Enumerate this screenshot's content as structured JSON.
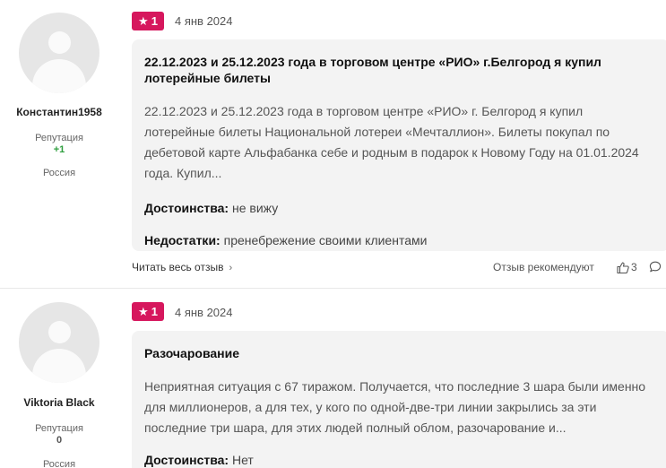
{
  "reviews": [
    {
      "author": {
        "name": "Константин1958",
        "reputation_label": "Репутация",
        "reputation_value": "+1",
        "country": "Россия"
      },
      "rating": "1",
      "date": "4 янв 2024",
      "title": "22.12.2023 и 25.12.2023 года в торговом центре «РИО» г.Белгород я купил лотерейные билеты",
      "text": "22.12.2023 и 25.12.2023 года в торговом центре «РИО» г. Белгород я купил лотерейные билеты Национальной лотереи «Мечталлион». Билеты покупал по дебетовой карте Альфабанка себе и родным в подарок к Новому Году на 01.01.2024 года. Купил...",
      "pros_label": "Достоинства:",
      "pros": "не вижу",
      "cons_label": "Недостатки:",
      "cons": "пренебрежение своими клиентами",
      "read_more": "Читать весь отзыв",
      "recommended": "Отзыв рекомендуют",
      "likes": "3"
    },
    {
      "author": {
        "name": "Viktoria Black",
        "reputation_label": "Репутация",
        "reputation_value": "0",
        "country": "Россия"
      },
      "rating": "1",
      "date": "4 янв 2024",
      "title": "Разочарование",
      "text": "Неприятная ситуация с 67 тиражом. Получается, что последние 3 шара были именно для миллионеров, а для тех, у кого по одной-две-три линии закрылись за эти последние три шара, для этих людей полный облом, разочарование и...",
      "pros_label": "Достоинства:",
      "pros": "Нет"
    }
  ],
  "colors": {
    "rating_badge": "#d6175d",
    "positive_reputation": "#2e9e3e",
    "card_background": "#f3f3f3"
  },
  "icons": [
    "user-avatar-icon",
    "star-icon",
    "chevron-right-icon",
    "thumbs-up-icon",
    "comment-icon"
  ]
}
